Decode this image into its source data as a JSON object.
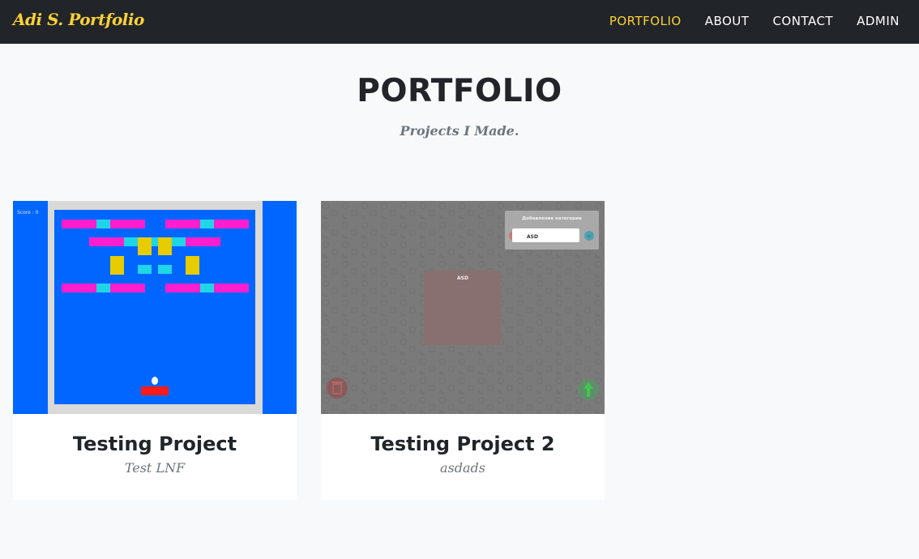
{
  "navbar": {
    "brand": "Adi S. Portfolio",
    "links": [
      {
        "label": "PORTFOLIO",
        "active": true
      },
      {
        "label": "ABOUT",
        "active": false
      },
      {
        "label": "CONTACT",
        "active": false
      },
      {
        "label": "ADMIN",
        "active": false
      }
    ]
  },
  "section": {
    "title": "PORTFOLIO",
    "subtitle": "Projects I Made."
  },
  "projects": [
    {
      "title": "Testing Project",
      "subtitle": "Test LNF",
      "thumbnail": {
        "score_text": "Score : 0"
      }
    },
    {
      "title": "Testing Project 2",
      "subtitle": "asdads",
      "thumbnail": {
        "dialog_title": "Добавление категории",
        "input_value": "ASD",
        "box_label": "ASD"
      }
    }
  ],
  "colors": {
    "navbar_bg": "#212529",
    "accent": "#fed136",
    "page_bg": "#f8f9fa",
    "muted_text": "#6c757d"
  }
}
